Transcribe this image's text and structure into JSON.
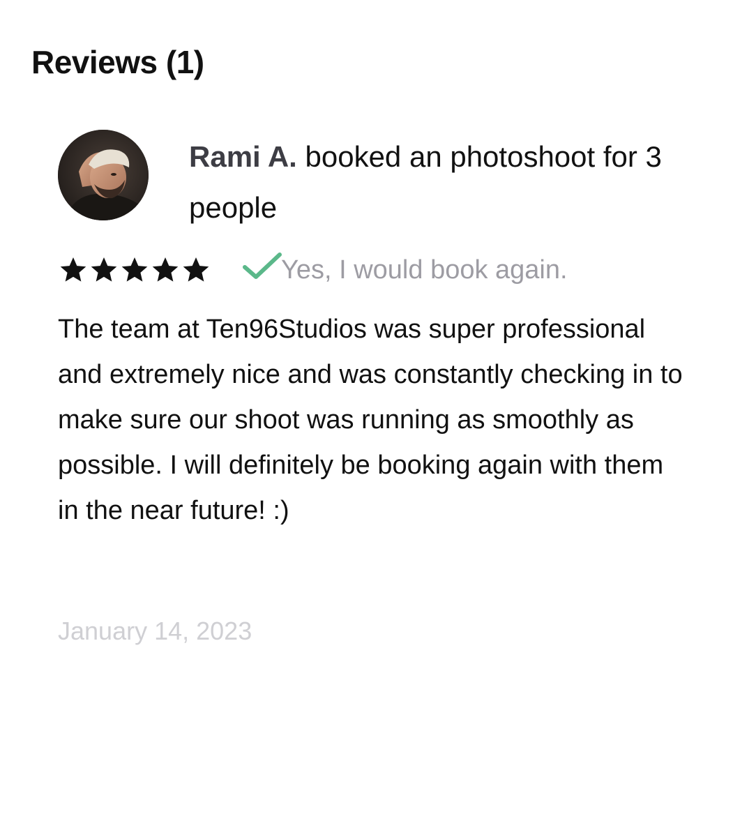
{
  "reviews": {
    "title": "Reviews (1)",
    "items": [
      {
        "reviewer_name": "Rami A.",
        "headline_rest": " booked an photoshoot for 3 people",
        "rating": 5,
        "rating_max": 5,
        "book_again_text": "Yes, I would book again.",
        "body": "The team at Ten96Studios was super professional and extremely nice and was constantly checking in to make sure our shoot was running as smoothly as possible. I will definitely be booking again with them in the near future! :)",
        "date": "January 14, 2023"
      }
    ]
  },
  "colors": {
    "text": "#111111",
    "name": "#3d3d44",
    "muted": "#9d9ca3",
    "date": "#cfcfd3",
    "check": "#5bb88a",
    "star": "#111111"
  },
  "icons": {
    "star": "star-icon",
    "check": "check-icon",
    "avatar": "avatar"
  }
}
